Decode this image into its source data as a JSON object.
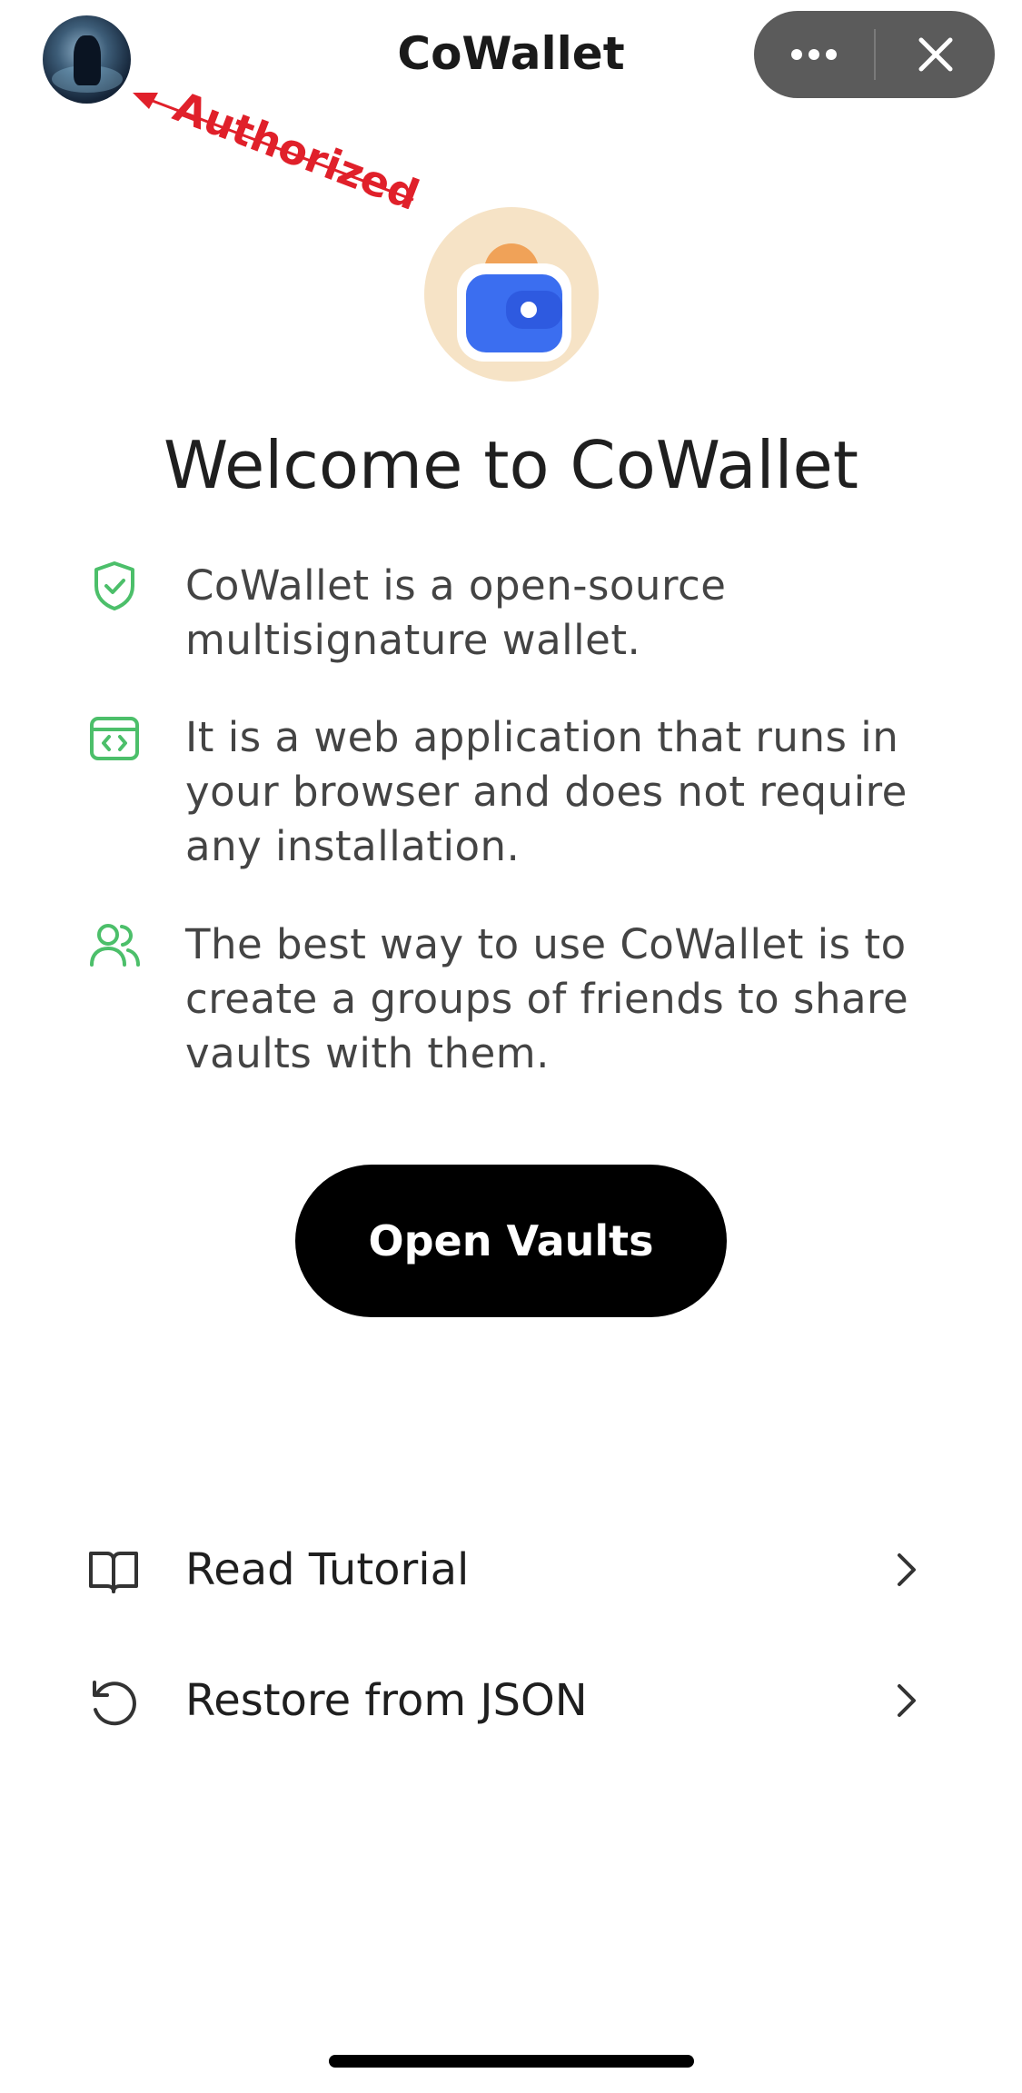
{
  "header": {
    "title": "CoWallet",
    "more_icon": "more-dots-icon",
    "close_icon": "close-icon"
  },
  "annotation": {
    "text": "Authorized",
    "color": "#e0202a"
  },
  "welcome": {
    "title": "Welcome to CoWallet"
  },
  "features": [
    {
      "icon": "shield-check-icon",
      "text": "CoWallet is a open-source multisignature wallet."
    },
    {
      "icon": "browser-code-icon",
      "text": "It is a web application that runs in your browser and does not require any installation."
    },
    {
      "icon": "users-icon",
      "text": "The best way to use CoWallet is to create a groups of friends to share vaults with them."
    }
  ],
  "primary_button": {
    "label": "Open Vaults"
  },
  "menu": [
    {
      "icon": "book-icon",
      "label": "Read Tutorial"
    },
    {
      "icon": "restore-icon",
      "label": "Restore from JSON"
    }
  ],
  "colors": {
    "accent_green": "#4cbf6a",
    "button_bg": "#000000",
    "capsule_bg": "#5b5b5b",
    "logo_bg": "#f6e3c6",
    "wallet_blue": "#3b6ef0"
  }
}
